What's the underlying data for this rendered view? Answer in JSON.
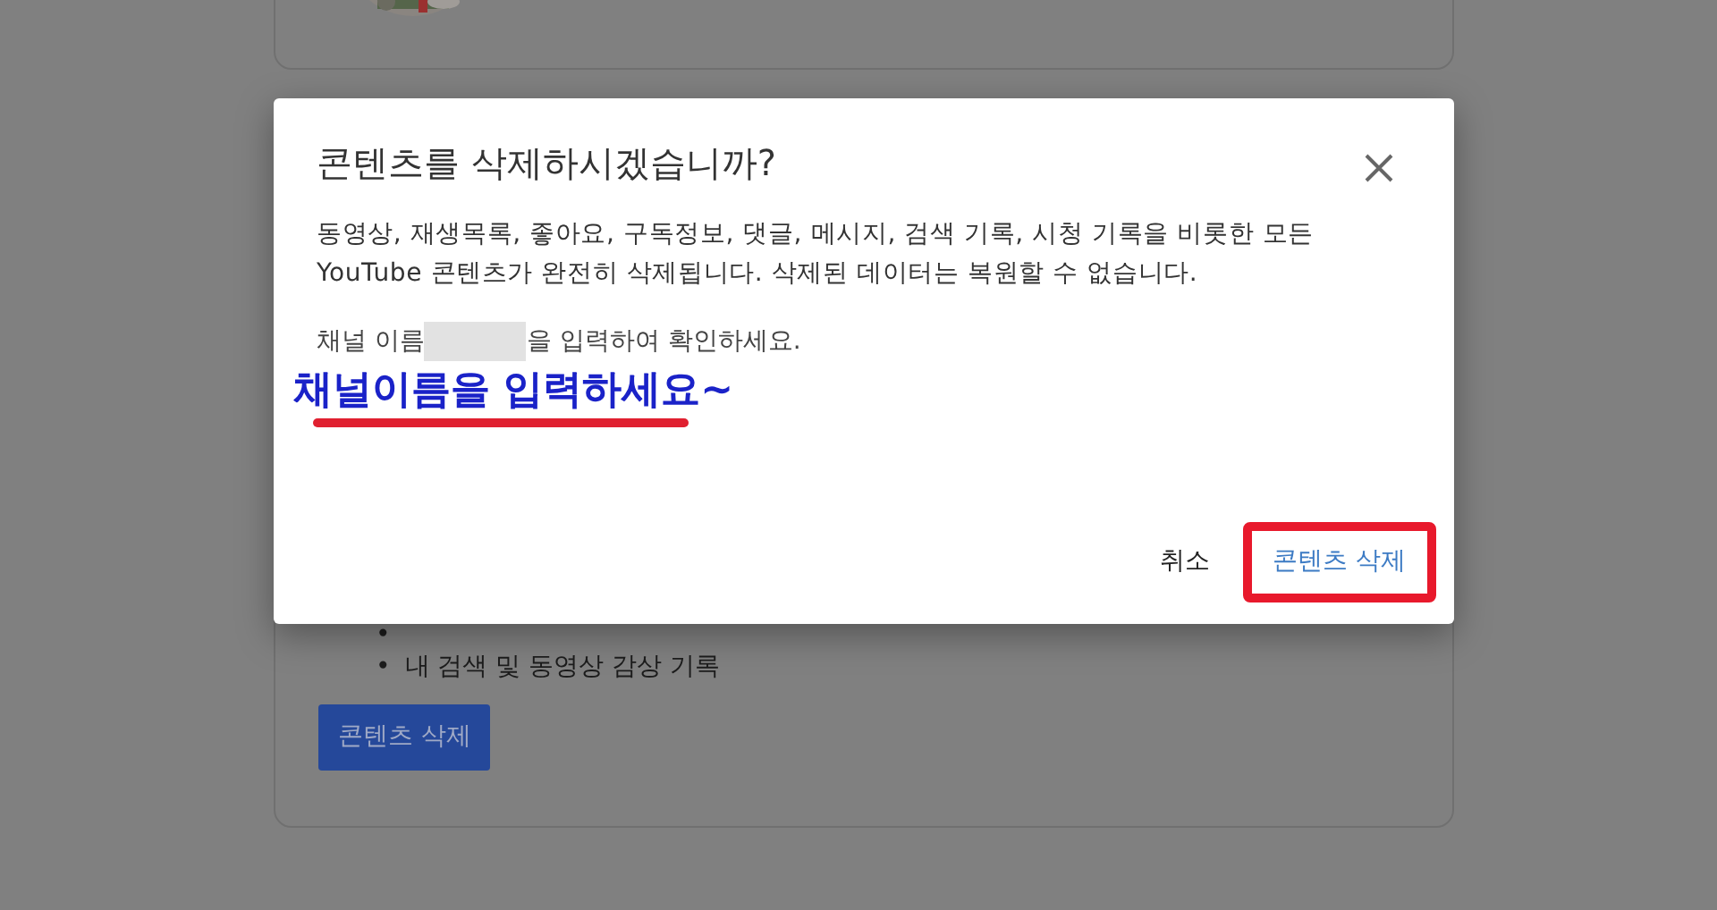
{
  "background": {
    "list_items": [
      {
        "marker": "•"
      },
      {
        "marker": "•",
        "text": "내 검색 및 동영상 감상 기록"
      }
    ],
    "button": "콘텐츠 삭제"
  },
  "dialog": {
    "title": "콘텐츠를 삭제하시겠습니까?",
    "message": "동영상, 재생목록, 좋아요, 구독정보, 댓글, 메시지, 검색 기록, 시청 기록을 비롯한 모든 YouTube 콘텐츠가 완전히 삭제됩니다. 삭제된 데이터는 복원할 수 없습니다.",
    "prompt_before": "채널 이름",
    "prompt_after": "을 입력하여 확인하세요.",
    "cancel": "취소",
    "confirm": "콘텐츠 삭제"
  },
  "annotation": {
    "text": "채널이름을 입력하세요~"
  }
}
